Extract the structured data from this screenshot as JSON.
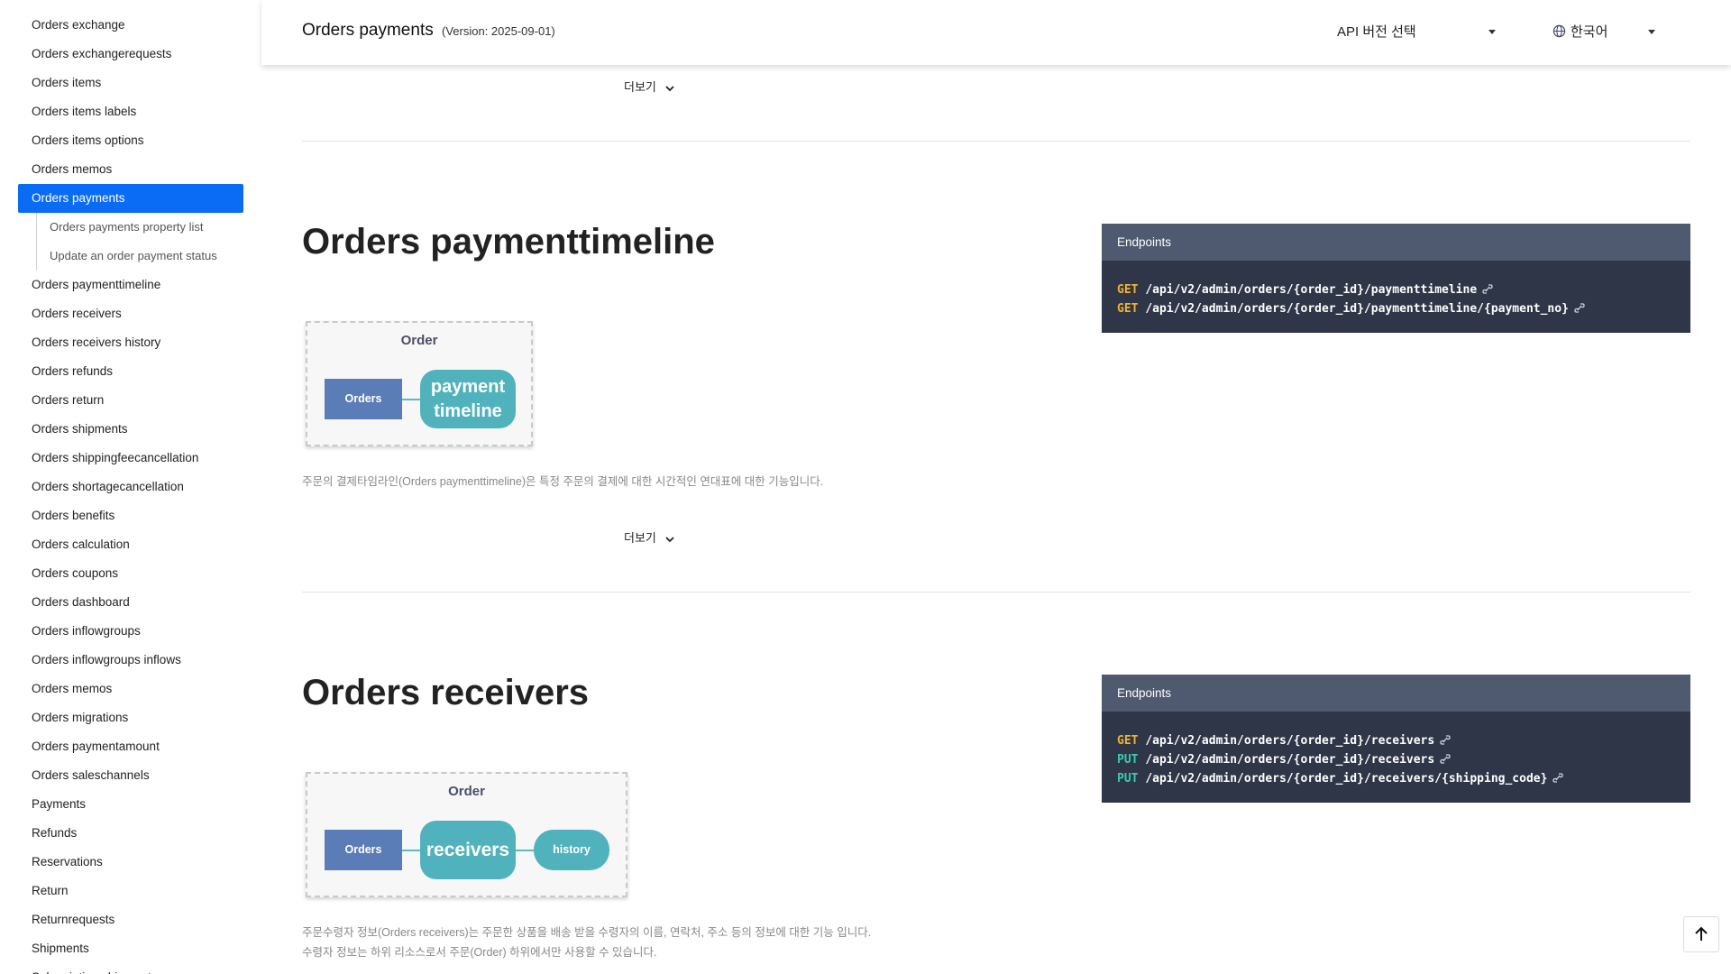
{
  "sidebar": {
    "items_before": [
      "Orders exchange",
      "Orders exchangerequests",
      "Orders items",
      "Orders items labels",
      "Orders items options",
      "Orders memos"
    ],
    "active": "Orders payments",
    "subitems": [
      "Orders payments property list",
      "Update an order payment status"
    ],
    "items_after": [
      "Orders paymenttimeline",
      "Orders receivers",
      "Orders receivers history",
      "Orders refunds",
      "Orders return",
      "Orders shipments",
      "Orders shippingfeecancellation",
      "Orders shortagecancellation",
      "Orders benefits",
      "Orders calculation",
      "Orders coupons",
      "Orders dashboard",
      "Orders inflowgroups",
      "Orders inflowgroups inflows",
      "Orders memos",
      "Orders migrations",
      "Orders paymentamount",
      "Orders saleschannels",
      "Payments",
      "Refunds",
      "Reservations",
      "Return",
      "Returnrequests",
      "Shipments",
      "Subscription shipments"
    ]
  },
  "header": {
    "title": "Orders payments",
    "version": "(Version: 2025-09-01)",
    "api_select": "API 버전 선택",
    "language": "한국어"
  },
  "main": {
    "more_label": "더보기",
    "sections": [
      {
        "title": "Orders paymenttimeline",
        "endpoints_label": "Endpoints",
        "endpoints": [
          {
            "method": "GET",
            "path": "/api/v2/admin/orders/{order_id}/paymenttimeline"
          },
          {
            "method": "GET",
            "path": "/api/v2/admin/orders/{order_id}/paymenttimeline/{payment_no}"
          }
        ],
        "diagram": {
          "label": "Order",
          "parent": "Orders",
          "main": "payment timeline"
        },
        "description": [
          "주문의 결제타임라인(Orders paymenttimeline)은 특정 주문의 결제에 대한 시간적인 연대표에 대한 기능입니다."
        ]
      },
      {
        "title": "Orders receivers",
        "endpoints_label": "Endpoints",
        "endpoints": [
          {
            "method": "GET",
            "path": "/api/v2/admin/orders/{order_id}/receivers"
          },
          {
            "method": "PUT",
            "path": "/api/v2/admin/orders/{order_id}/receivers"
          },
          {
            "method": "PUT",
            "path": "/api/v2/admin/orders/{order_id}/receivers/{shipping_code}"
          }
        ],
        "diagram": {
          "label": "Order",
          "parent": "Orders",
          "main": "receivers",
          "child": "history"
        },
        "description": [
          "주문수령자 정보(Orders receivers)는 주문한 상품을 배송 받을 수령자의 이름, 연락처, 주소 등의 정보에 대한 기능 입니다.",
          "수령자 정보는 하위 리소스로서 주문(Order) 하위에서만 사용할 수 있습니다."
        ]
      }
    ]
  },
  "colors": {
    "active": "#0a6cf5",
    "endpoint_bg": "#2e3648",
    "get": "#f2b232",
    "put": "#3ec9b0",
    "diagram_teal": "#4fb2bd",
    "diagram_blue": "#5b7db7"
  }
}
